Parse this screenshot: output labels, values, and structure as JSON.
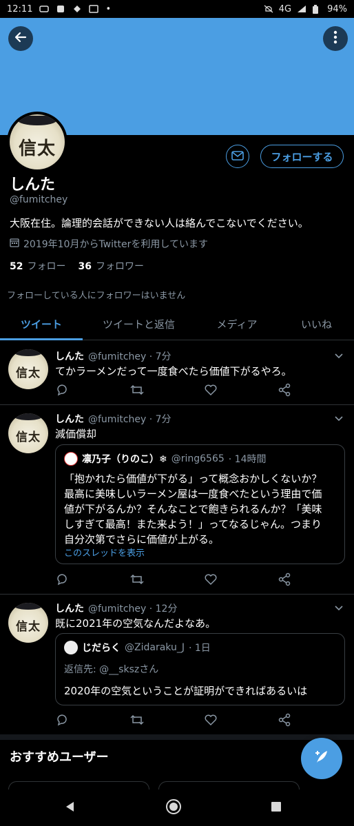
{
  "status_bar": {
    "time": "12:11",
    "network": "4G",
    "battery": "94%"
  },
  "profile": {
    "avatar_glyph": "信太",
    "name": "しんた",
    "handle": "@fumitchey",
    "bio": "大阪在住。論理的会話ができない人は絡んでこないでください。",
    "joined": "2019年10月からTwitterを利用しています",
    "following_count": "52",
    "following_label": "フォロー",
    "followers_count": "36",
    "followers_label": "フォロワー",
    "followers_note": "フォローしている人にフォロワーはいません",
    "follow_button": "フォローする"
  },
  "tabs": [
    {
      "label": "ツイート",
      "active": true
    },
    {
      "label": "ツイートと返信",
      "active": false
    },
    {
      "label": "メディア",
      "active": false
    },
    {
      "label": "いいね",
      "active": false
    }
  ],
  "tweets": [
    {
      "name": "しんた",
      "handle": "@fumitchey",
      "time": "· 7分",
      "text": "てかラーメンだって一度食べたら価値下がるやろ。"
    },
    {
      "name": "しんた",
      "handle": "@fumitchey",
      "time": "· 7分",
      "text": "減価償却",
      "quote": {
        "name": "凛乃子（りのこ）❄",
        "handle": "@ring6565",
        "time": "· 14時間",
        "lines": [
          "「抱かれたら価値が下がる」って概念おかしくないか？",
          "最高に美味しいラーメン屋は一度食べたという理由で価",
          "値が下がるんか？そんなことで飽きられるんか？「美味",
          "しすぎて最高！また来よう！」ってなるじゃん。つまり",
          "自分次第でさらに価値が上がる。"
        ],
        "show_thread": "このスレッドを表示"
      }
    },
    {
      "name": "しんた",
      "handle": "@fumitchey",
      "time": "· 12分",
      "text": "既に2021年の空気なんだよなあ。",
      "quote": {
        "name": "じだらく",
        "handle": "@Zidaraku_J",
        "time": "· 1日",
        "reply_to": "返信先: @__sksz",
        "reply_suffix": "さん",
        "body": "2020年の空気ということが証明ができればあるいは"
      }
    }
  ],
  "suggestions": {
    "title": "おすすめユーザー"
  },
  "colors": {
    "accent": "#4b9ee3",
    "banner": "#4b9ee3",
    "background": "#000000",
    "muted": "#8b98a5"
  },
  "icons": [
    "back-arrow-icon",
    "more-vertical-icon",
    "mail-icon",
    "calendar-icon",
    "chevron-down-icon",
    "reply-icon",
    "retweet-icon",
    "like-icon",
    "share-icon",
    "compose-icon",
    "nav-back-icon",
    "nav-home-icon",
    "nav-recents-icon"
  ]
}
